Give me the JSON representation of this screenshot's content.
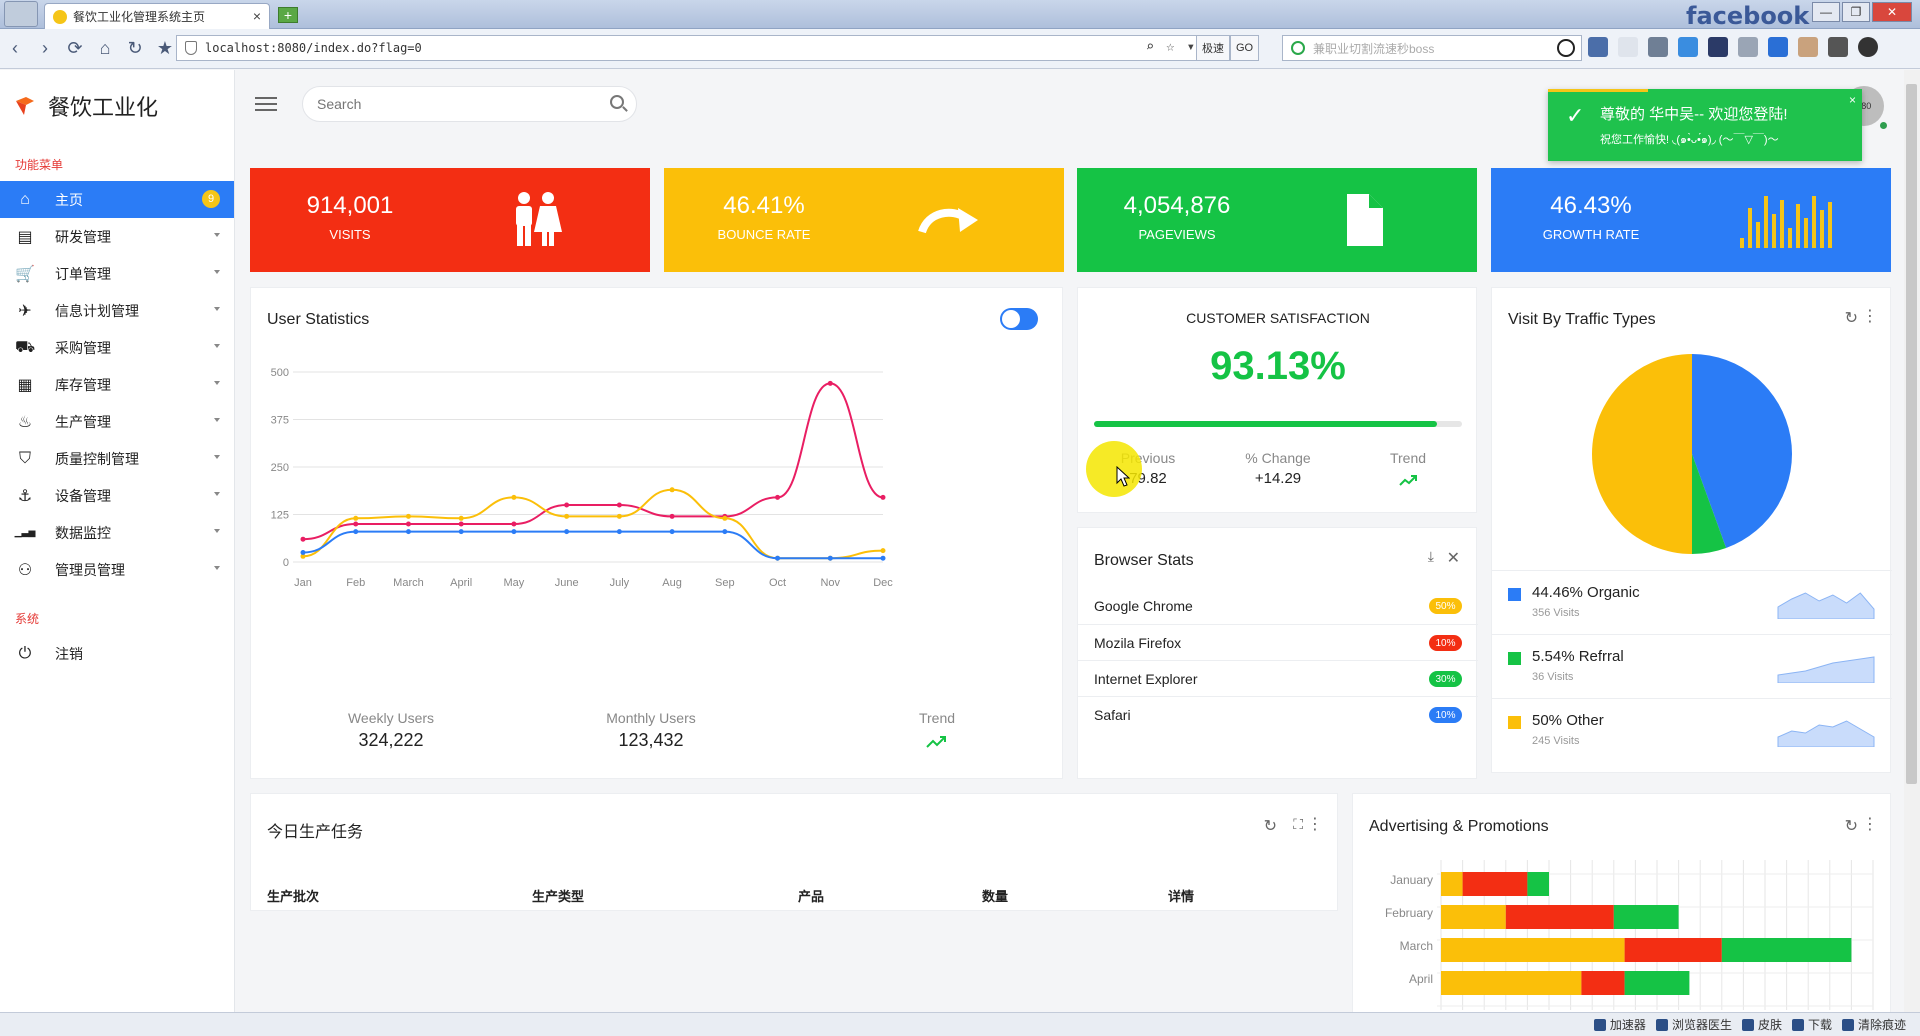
{
  "browser": {
    "tab_title": "餐饮工业化管理系统主页",
    "url": "localhost:8080/index.do?flag=0",
    "speed_label": "极速",
    "go_label": "GO",
    "search_placeholder": "兼职业切割流速秒boss",
    "fb_title": "facebook"
  },
  "statusbar": {
    "items": [
      "加速器",
      "浏览器医生",
      "皮肤",
      "下载",
      "清除痕迹"
    ]
  },
  "sidebar": {
    "brand": "餐饮工业化",
    "section_menu": "功能菜单",
    "items": [
      {
        "label": "主页",
        "icon": "home-icon",
        "badge": "9"
      },
      {
        "label": "研发管理",
        "icon": "book-icon"
      },
      {
        "label": "订单管理",
        "icon": "cart-icon"
      },
      {
        "label": "信息计划管理",
        "icon": "paper-plane-icon"
      },
      {
        "label": "采购管理",
        "icon": "truck-icon"
      },
      {
        "label": "库存管理",
        "icon": "grid-icon"
      },
      {
        "label": "生产管理",
        "icon": "fire-icon"
      },
      {
        "label": "质量控制管理",
        "icon": "html5-icon"
      },
      {
        "label": "设备管理",
        "icon": "anchor-icon"
      },
      {
        "label": "数据监控",
        "icon": "signal-icon"
      },
      {
        "label": "管理员管理",
        "icon": "user-icon"
      }
    ],
    "section_system": "系统",
    "logout": "注销"
  },
  "header": {
    "search_placeholder": "Search",
    "avatar_text": "x80"
  },
  "toast": {
    "title": "尊敬的 华中吴-- 欢迎您登陆!",
    "subtitle": "祝您工作愉快! ◟(๑•̀ᴗ•́๑)◞ (～￣▽￣)～",
    "close": "×"
  },
  "kpis": [
    {
      "value": "914,001",
      "label": "VISITS",
      "color": "#f32e13",
      "icon": "people-icon"
    },
    {
      "value": "46.41%",
      "label": "BOUNCE RATE",
      "color": "#fbbf09",
      "icon": "redo-arrow-icon"
    },
    {
      "value": "4,054,876",
      "label": "PAGEVIEWS",
      "color": "#15c345",
      "icon": "file-icon"
    },
    {
      "value": "46.43%",
      "label": "GROWTH RATE",
      "color": "#2b7cf6",
      "icon": "bar-chart-icon"
    }
  ],
  "user_statistics": {
    "title": "User Statistics",
    "weekly_label": "Weekly Users",
    "weekly_value": "324,222",
    "monthly_label": "Monthly Users",
    "monthly_value": "123,432",
    "trend_label": "Trend"
  },
  "chart_data": [
    {
      "type": "line",
      "categories": [
        "Jan",
        "Feb",
        "March",
        "April",
        "May",
        "June",
        "July",
        "Aug",
        "Sep",
        "Oct",
        "Nov",
        "Dec"
      ],
      "ylim": [
        0,
        500
      ],
      "yticks": [
        0,
        125,
        250,
        375,
        500
      ],
      "series": [
        {
          "color": "#e91e63",
          "values": [
            60,
            100,
            100,
            100,
            100,
            150,
            150,
            120,
            120,
            170,
            470,
            170
          ]
        },
        {
          "color": "#fbbf09",
          "values": [
            15,
            115,
            120,
            115,
            170,
            120,
            120,
            190,
            115,
            10,
            10,
            30
          ]
        },
        {
          "color": "#2b7cf6",
          "values": [
            25,
            80,
            80,
            80,
            80,
            80,
            80,
            80,
            80,
            10,
            10,
            10
          ]
        }
      ]
    },
    {
      "type": "pie",
      "categories": [
        "Organic",
        "Refrral",
        "Other"
      ],
      "values": [
        44.46,
        5.54,
        50
      ],
      "colors": [
        "#2b7cf6",
        "#15c345",
        "#fbbf09"
      ]
    },
    {
      "type": "bar",
      "stacked": true,
      "orientation": "horizontal",
      "categories": [
        "January",
        "February",
        "March",
        "April"
      ],
      "series": [
        {
          "color": "#fbbf09",
          "values": [
            1,
            3,
            8.5,
            6.5
          ]
        },
        {
          "color": "#f32e13",
          "values": [
            3,
            5,
            4.5,
            2
          ]
        },
        {
          "color": "#15c345",
          "values": [
            1,
            3,
            6,
            3
          ]
        }
      ]
    }
  ],
  "customer_satisfaction": {
    "title": "CUSTOMER SATISFACTION",
    "value": "93.13%",
    "progress": 0.9313,
    "previous_label": "Previous",
    "previous_value": "79.82",
    "change_label": "% Change",
    "change_value": "+14.29",
    "trend_label": "Trend"
  },
  "browser_stats": {
    "title": "Browser Stats",
    "rows": [
      {
        "name": "Google Chrome",
        "pct": "50%",
        "color": "#fbbf09"
      },
      {
        "name": "Mozila Firefox",
        "pct": "10%",
        "color": "#f32e13"
      },
      {
        "name": "Internet Explorer",
        "pct": "30%",
        "color": "#15c345"
      },
      {
        "name": "Safari",
        "pct": "10%",
        "color": "#2b7cf6"
      }
    ]
  },
  "traffic": {
    "title": "Visit By Traffic Types",
    "rows": [
      {
        "title": "44.46% Organic",
        "sub": "356 Visits",
        "color": "#2b7cf6"
      },
      {
        "title": "5.54% Refrral",
        "sub": "36 Visits",
        "color": "#15c345"
      },
      {
        "title": "50% Other",
        "sub": "245 Visits",
        "color": "#fbbf09"
      }
    ]
  },
  "production": {
    "title": "今日生产任务",
    "columns": [
      "生产批次",
      "生产类型",
      "产品",
      "数量",
      "详情"
    ]
  },
  "advertising": {
    "title": "Advertising & Promotions"
  }
}
